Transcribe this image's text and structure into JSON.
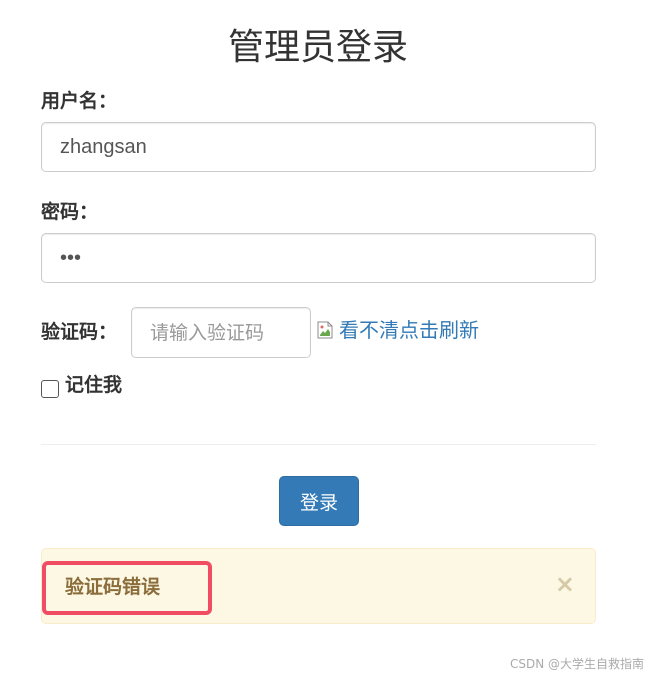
{
  "page": {
    "title": "管理员登录"
  },
  "form": {
    "username_label": "用户名：",
    "username_value": "zhangsan",
    "password_label": "密码：",
    "password_value": "•••",
    "captcha_label": "验证码：",
    "captcha_placeholder": "请输入验证码",
    "captcha_image_alt": "看不清点击刷新",
    "remember_label": "记住我",
    "login_button": "登录"
  },
  "alert": {
    "message": "验证码错误",
    "close_symbol": "×",
    "colors": {
      "background": "#fcf8e3",
      "text": "#8a6d3b",
      "highlight": "#f04c63"
    }
  },
  "icons": {
    "broken_image": "broken-image-icon",
    "close": "close-icon"
  },
  "colors": {
    "primary": "#337ab7",
    "link": "#337ab7"
  },
  "watermark": "CSDN @大学生自救指南"
}
